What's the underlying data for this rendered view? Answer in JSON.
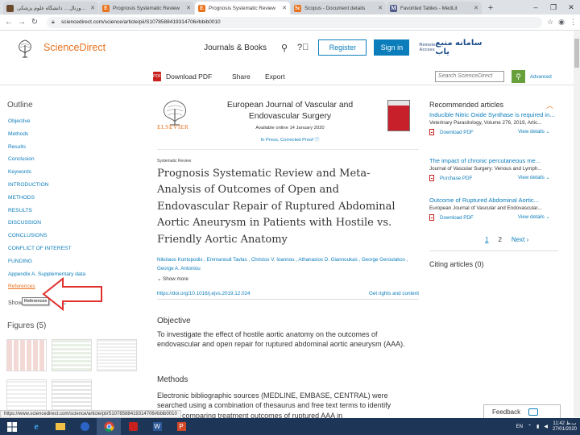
{
  "browser": {
    "tabs": [
      {
        "label": "لامبالیک مونوژورنال ... دانشگاه علوم پزشکی",
        "favicon_color": "#6b4a2b",
        "active": false
      },
      {
        "label": "Prognosis Systematic Review",
        "favicon_color": "#e9711c",
        "active": false
      },
      {
        "label": "Prognosis Systematic Review",
        "favicon_color": "#e9711c",
        "active": true
      },
      {
        "label": "Scopus - Document details",
        "favicon_color": "#e9711c",
        "active": false
      },
      {
        "label": "Favorited Tables - MedLit",
        "favicon_color": "#4f5a8a",
        "active": false
      }
    ],
    "new_tab_glyph": "+",
    "url": "sciencedirect.com/science/article/pii/S1078588419314706#bbib0010"
  },
  "header": {
    "brand": "ScienceDirect",
    "journals_link": "Journals & Books",
    "register": "Register",
    "sign_in": "Sign in",
    "remote_access_small": "Remote Access",
    "remote_access_name": "سامانه منبع یاب"
  },
  "article_toolbar": {
    "download_pdf": "Download PDF",
    "pdf_icon_text": "PDF",
    "share": "Share",
    "export": "Export",
    "search_placeholder": "Search ScienceDirect",
    "advanced": "Advanced"
  },
  "outline": {
    "title": "Outline",
    "items": [
      "Objective",
      "Methods",
      "Results",
      "Conclusion",
      "Keywords",
      "INTRODUCTION",
      "METHODS",
      "RESULTS",
      "DISCUSSION",
      "CONCLUSIONS",
      "CONFLICT OF INTEREST",
      "FUNDING",
      "Appendix A. Supplementary data",
      "References"
    ],
    "show_full": "Show",
    "tooltip": "References"
  },
  "figures": {
    "title": "Figures (5)"
  },
  "article": {
    "publisher": "ELSEVIER",
    "journal_title": "European Journal of Vascular and Endovascular Surgery",
    "available_online": "Available online 14 January 2020",
    "in_press": "In Press, Corrected Proof",
    "article_type": "Systematic Review",
    "title": "Prognosis Systematic Review and Meta-Analysis of Outcomes of Open and Endovascular Repair of Ruptured Abdominal Aortic Aneurysm in Patients with Hostile vs. Friendly Aortic Anatomy",
    "authors": "Nikolaos Kontopodis , Emmanouil Tavlas , Christos V. Ioannou , Athanasios D. Giannoukas , George Geroulakos , George A. Antoniou",
    "show_more": "Show more",
    "doi": "https://doi.org/10.1016/j.ejvs.2019.12.024",
    "rights": "Get rights and content",
    "objective_heading": "Objective",
    "objective_text": "To investigate the effect of hostile aortic anatomy on the outcomes of endovascular and open repair for ruptured abdominal aortic aneurysm (AAA).",
    "methods_heading": "Methods",
    "methods_text": "Electronic bibliographic sources (MEDLINE, EMBASE, CENTRAL) were searched using a combination of thesaurus and free text terms to identify studies comparing treatment outcomes of ruptured AAA in"
  },
  "recommended": {
    "title": "Recommended articles",
    "items": [
      {
        "title": "Inducible Nitric Oxide Synthase is required in...",
        "source": "Veterinary Parasitology, Volume 276, 2019, Artic...",
        "action": "Download PDF",
        "details": "View details"
      },
      {
        "title": "The impact of chronic percutaneous me...",
        "source": "Journal of Vascular Surgery: Venous and Lymph...",
        "action": "Purchase PDF",
        "details": "View details"
      },
      {
        "title": "Outcome of Ruptured Abdominal Aortic...",
        "source": "European Journal of Vascular and Endovascular...",
        "action": "Download PDF",
        "details": "View details"
      }
    ],
    "pages": [
      "1",
      "2"
    ],
    "next": "Next",
    "citing": "Citing articles (0)"
  },
  "feedback": "Feedback",
  "status_url": "https://www.sciencedirect.com/science/article/pii/S1078588419314706#bbib0010",
  "taskbar": {
    "lang": "EN",
    "time": "11:42 ب.ظ",
    "date": "27/01/2020"
  },
  "colors": {
    "accent_orange": "#e9711c",
    "link_blue": "#0c7dbb",
    "search_green": "#67a03b",
    "pdf_red": "#c7201d",
    "taskbar": "#1d3556"
  }
}
